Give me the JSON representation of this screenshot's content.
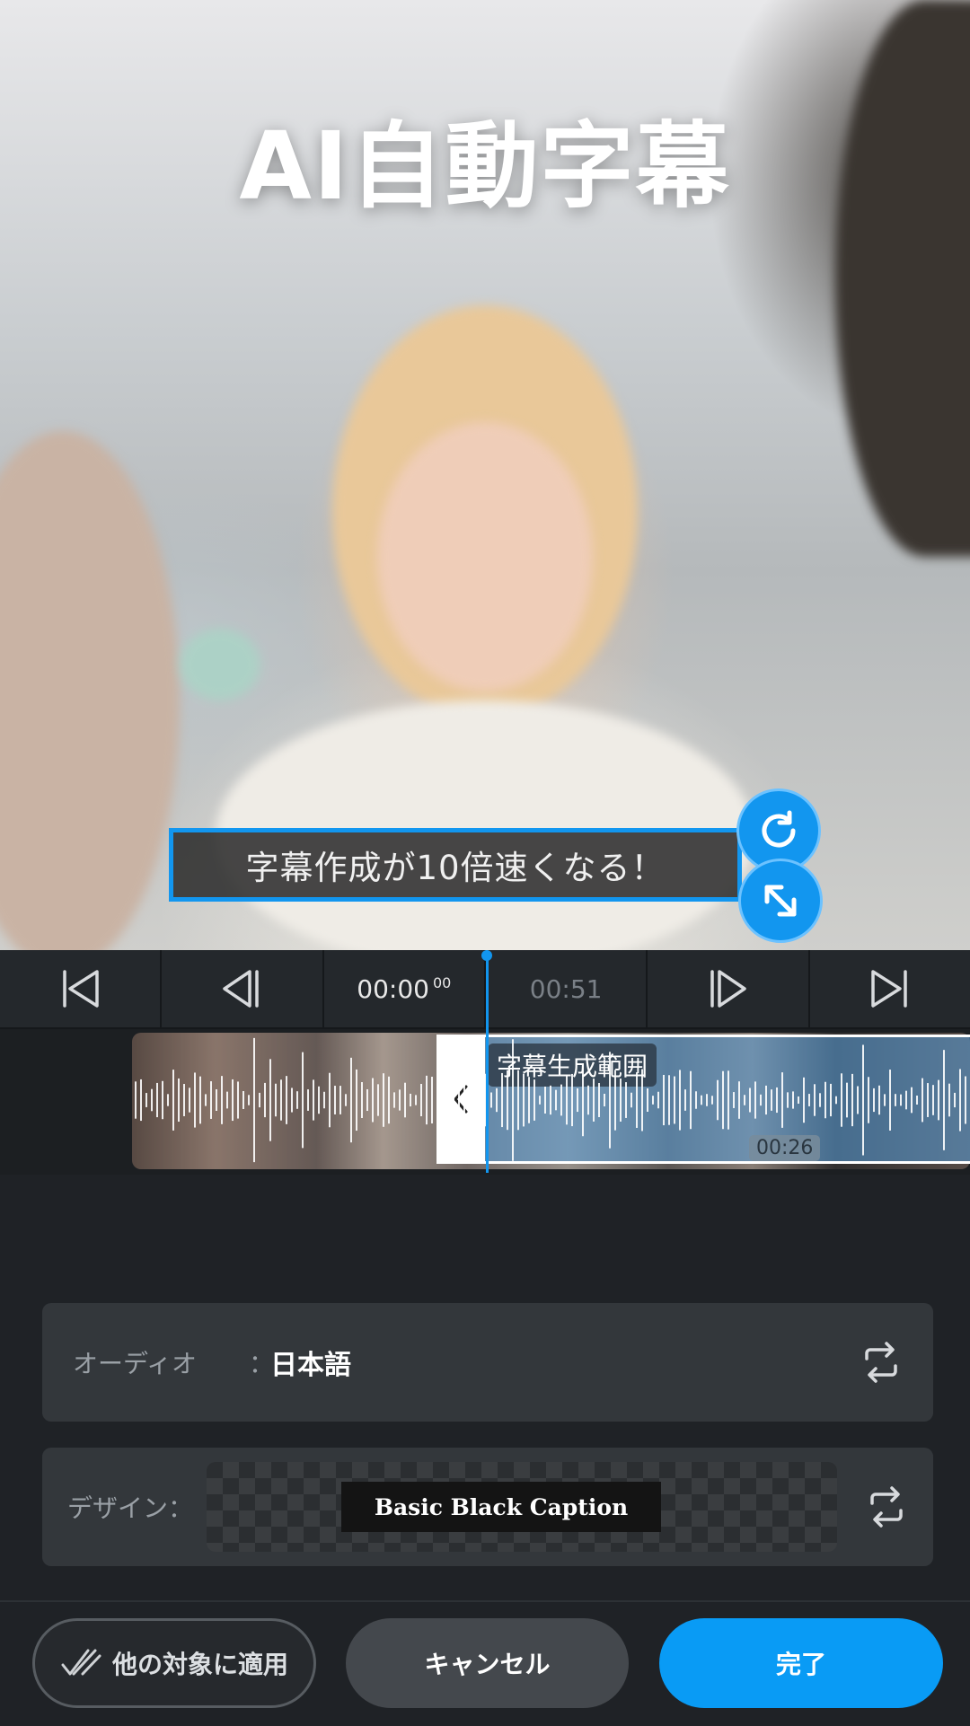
{
  "preview": {
    "headline": "AI自動字幕",
    "caption_text": "字幕作成が10倍速くなる！"
  },
  "transport": {
    "current_time": "00:00",
    "current_frames": "00",
    "total_time": "00:51"
  },
  "timeline": {
    "range_label": "字幕生成範囲",
    "range_time": "00:26"
  },
  "settings": {
    "audio_label": "オーディオ",
    "audio_colon": "：",
    "audio_value": "日本語",
    "design_label": "デザイン：",
    "design_value": "Basic Black Caption"
  },
  "footer": {
    "apply_others_label": "他の対象に適用",
    "cancel_label": "キャンセル",
    "done_label": "完了"
  },
  "colors": {
    "accent": "#099bf5",
    "background": "#1f2226",
    "panel": "#33373b"
  },
  "icons": {
    "rotate": "rotate-icon",
    "resize": "resize-icon",
    "skip_start": "skip-to-start-icon",
    "step_back": "step-back-icon",
    "step_forward": "step-forward-icon",
    "skip_end": "skip-to-end-icon",
    "swap": "swap-icon",
    "double_check": "double-check-icon",
    "chevron_left": "chevron-left-icon"
  }
}
